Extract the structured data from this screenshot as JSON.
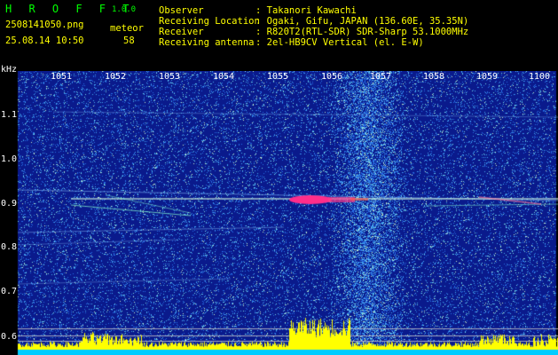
{
  "header": {
    "logo": "H R O F F T",
    "version": "1.0.0",
    "filename": "2508141050.png",
    "mode_label": "meteor",
    "datetime": "25.08.14 10:50",
    "count": "58",
    "info": [
      {
        "label": "Observer",
        "value": ": Takanori Kawachi"
      },
      {
        "label": "Receiving Location",
        "value": ": Ogaki, Gifu, JAPAN (136.60E, 35.35N)"
      },
      {
        "label": "Receiver",
        "value": ": R820T2(RTL-SDR) SDR-Sharp 53.1000MHz"
      },
      {
        "label": "Receiving antenna",
        "value": ": 2el-HB9CV Vertical (el. E-W)"
      }
    ]
  },
  "spectrogram": {
    "x_ticks": [
      "1051",
      "1052",
      "1053",
      "1054",
      "1055",
      "1056",
      "1057",
      "1058",
      "1059",
      "1100"
    ],
    "y_unit": "kHz",
    "y_ticks": [
      "1.1",
      "1.0",
      "0.9",
      "0.8",
      "0.7",
      "0.6"
    ],
    "colors": {
      "background": "#0a1a8c",
      "noise": "#2a6ae0",
      "meteor": "#ff2d8a",
      "bar": "#ffff00",
      "floor": "#00ccff"
    }
  }
}
